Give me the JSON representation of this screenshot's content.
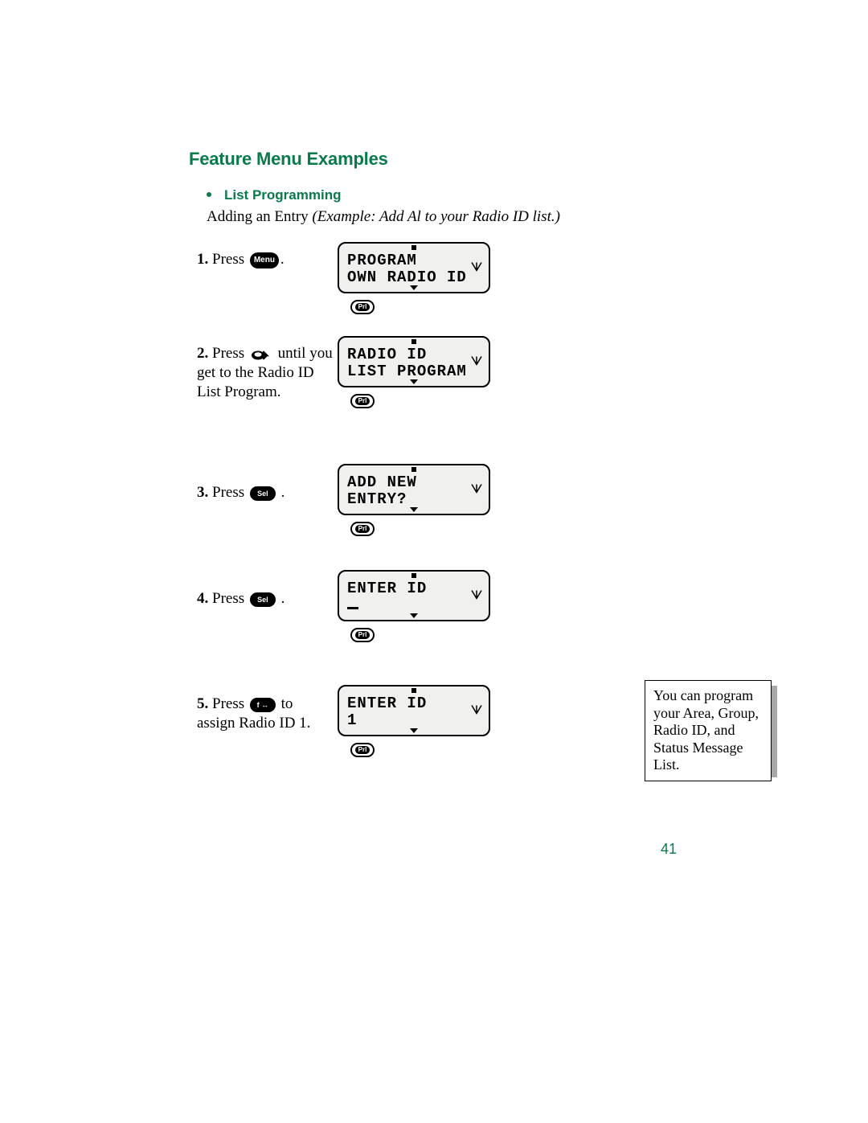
{
  "heading": "Feature Menu Examples",
  "subheading": "List Programming",
  "intro_regular": "Adding an Entry ",
  "intro_italic": "(Example: Add Al to your Radio ID list.)",
  "icons": {
    "menu_label": "Menu",
    "sel_label": "Sel",
    "prl_label": "Prl"
  },
  "steps": [
    {
      "num": "1.",
      "text_before": " Press ",
      "btn": "menu",
      "text_after": ".",
      "lcd": {
        "line1": "PROGRAM",
        "line2": "OWN RADIO ID"
      }
    },
    {
      "num": "2.",
      "text_before": " Press ",
      "btn": "scroll",
      "text_after": " until you get to the Radio ID List Program.",
      "lcd": {
        "line1": "RADIO ID",
        "line2": "LIST PROGRAM"
      }
    },
    {
      "num": "3.",
      "text_before": " Press ",
      "btn": "sel",
      "text_after": " .",
      "lcd": {
        "line1": "ADD NEW",
        "line2": "ENTRY?"
      }
    },
    {
      "num": "4.",
      "text_before": " Press ",
      "btn": "sel",
      "text_after": " .",
      "lcd": {
        "line1": "ENTER ID",
        "line2": "_"
      }
    },
    {
      "num": "5.",
      "text_before": " Press ",
      "btn": "f",
      "text_after": " to assign Radio ID 1.",
      "lcd": {
        "line1": "ENTER ID",
        "line2": "1"
      }
    }
  ],
  "note": "You can program your Area, Group, Radio ID, and Status Message List.",
  "page_number": "41"
}
